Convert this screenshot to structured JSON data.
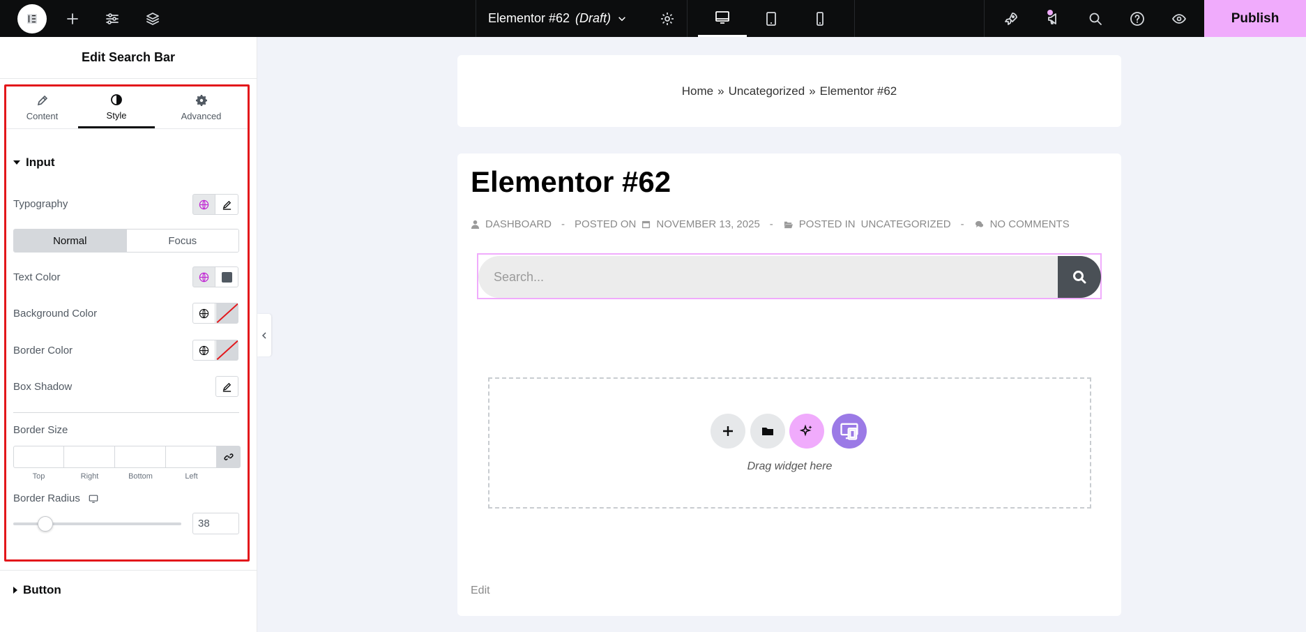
{
  "topbar": {
    "doc_title": "Elementor #62",
    "doc_status": "(Draft)",
    "publish_label": "Publish"
  },
  "panel": {
    "title": "Edit Search Bar",
    "tabs": [
      {
        "label": "Content",
        "icon": "pencil-icon"
      },
      {
        "label": "Style",
        "icon": "half-circle-icon"
      },
      {
        "label": "Advanced",
        "icon": "gear-icon"
      }
    ],
    "active_tab": "Style",
    "input_section": {
      "title": "Input",
      "typography_label": "Typography",
      "state_toggle": {
        "normal": "Normal",
        "focus": "Focus",
        "active": "Normal"
      },
      "text_color_label": "Text Color",
      "background_color_label": "Background Color",
      "border_color_label": "Border Color",
      "box_shadow_label": "Box Shadow",
      "border_size_label": "Border Size",
      "border_size_sides": [
        "Top",
        "Right",
        "Bottom",
        "Left"
      ],
      "border_radius_label": "Border Radius",
      "border_radius_value": "38"
    },
    "button_section": {
      "title": "Button"
    }
  },
  "canvas": {
    "breadcrumb": [
      "Home",
      "»",
      "Uncategorized",
      "»",
      "Elementor #62"
    ],
    "post_title": "Elementor #62",
    "meta": {
      "author": "DASHBOARD",
      "posted_on_label": "POSTED ON",
      "date": "NOVEMBER 13, 2025",
      "posted_in_label": "POSTED IN",
      "category": "UNCATEGORIZED",
      "comments": "NO COMMENTS"
    },
    "search_placeholder": "Search...",
    "dropzone_text": "Drag widget here",
    "edit_link": "Edit"
  },
  "colors": {
    "accent_pink": "#f0abfc",
    "accent_purple": "#9b7ae6",
    "highlight_red": "#e3171b",
    "topbar_bg": "#0c0d0e"
  }
}
